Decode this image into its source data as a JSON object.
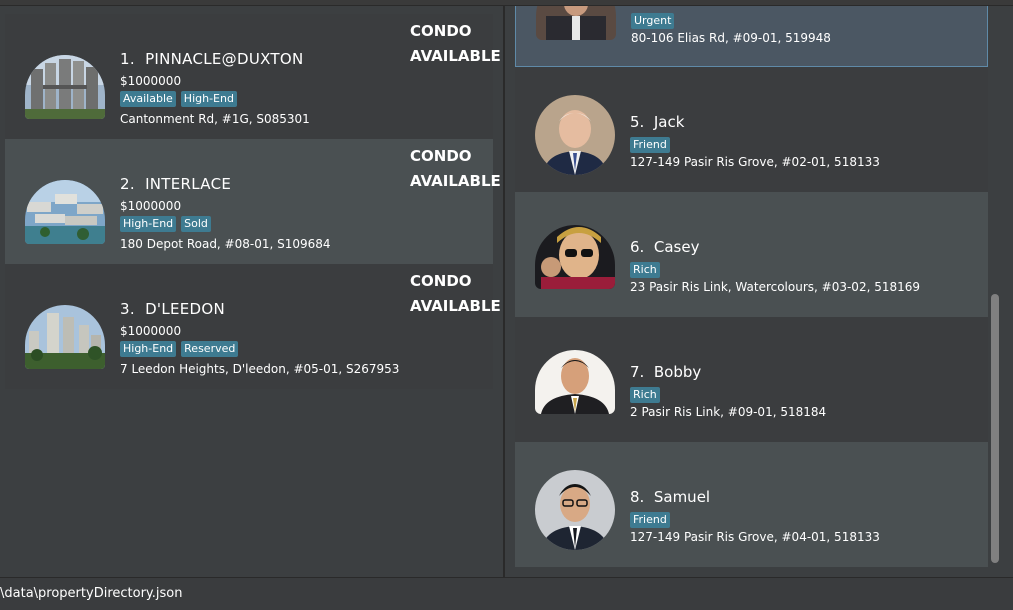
{
  "properties": [
    {
      "index": "1.",
      "name": "PINNACLE@DUXTON",
      "price": "$1000000",
      "tags": [
        "Available",
        "High-End"
      ],
      "address": "Cantonment Rd, #1G, S085301",
      "type": "CONDO",
      "status": "AVAILABLE",
      "image": "apartment-towers-photo"
    },
    {
      "index": "2.",
      "name": "INTERLACE",
      "price": "$1000000",
      "tags": [
        "High-End",
        "Sold"
      ],
      "address": "180 Depot Road, #08-01, S109684",
      "type": "CONDO",
      "status": "AVAILABLE",
      "image": "apartment-complex-photo"
    },
    {
      "index": "3.",
      "name": "D'LEEDON",
      "price": "$1000000",
      "tags": [
        "High-End",
        "Reserved"
      ],
      "address": "7 Leedon Heights, D'leedon, #05-01, S267953",
      "type": "CONDO",
      "status": "AVAILABLE",
      "image": "tower-buildings-photo"
    }
  ],
  "people": [
    {
      "index": "",
      "name": "",
      "tags": [
        "Urgent"
      ],
      "address": "80-106 Elias Rd, #09-01, 519948",
      "image": "person-photo"
    },
    {
      "index": "5.",
      "name": "Jack",
      "tags": [
        "Friend"
      ],
      "address": "127-149 Pasir Ris Grove, #02-01, 518133",
      "image": "person-photo"
    },
    {
      "index": "6.",
      "name": "Casey",
      "tags": [
        "Rich"
      ],
      "address": "23 Pasir Ris Link, Watercolours, #03-02, 518169",
      "image": "person-photo"
    },
    {
      "index": "7.",
      "name": "Bobby",
      "tags": [
        "Rich"
      ],
      "address": "2 Pasir Ris Link, #09-01, 518184",
      "image": "person-photo"
    },
    {
      "index": "8.",
      "name": "Samuel",
      "tags": [
        "Friend"
      ],
      "address": "127-149 Pasir Ris Grove, #04-01, 518133",
      "image": "person-photo"
    }
  ],
  "status_bar": {
    "path": "\\data\\propertyDirectory.json"
  },
  "colors": {
    "background": "#3c3f41",
    "card": "#3b3d3f",
    "card_alt": "#4a5052",
    "tag": "#3e7b91",
    "selected_border": "#5f8aa8"
  }
}
